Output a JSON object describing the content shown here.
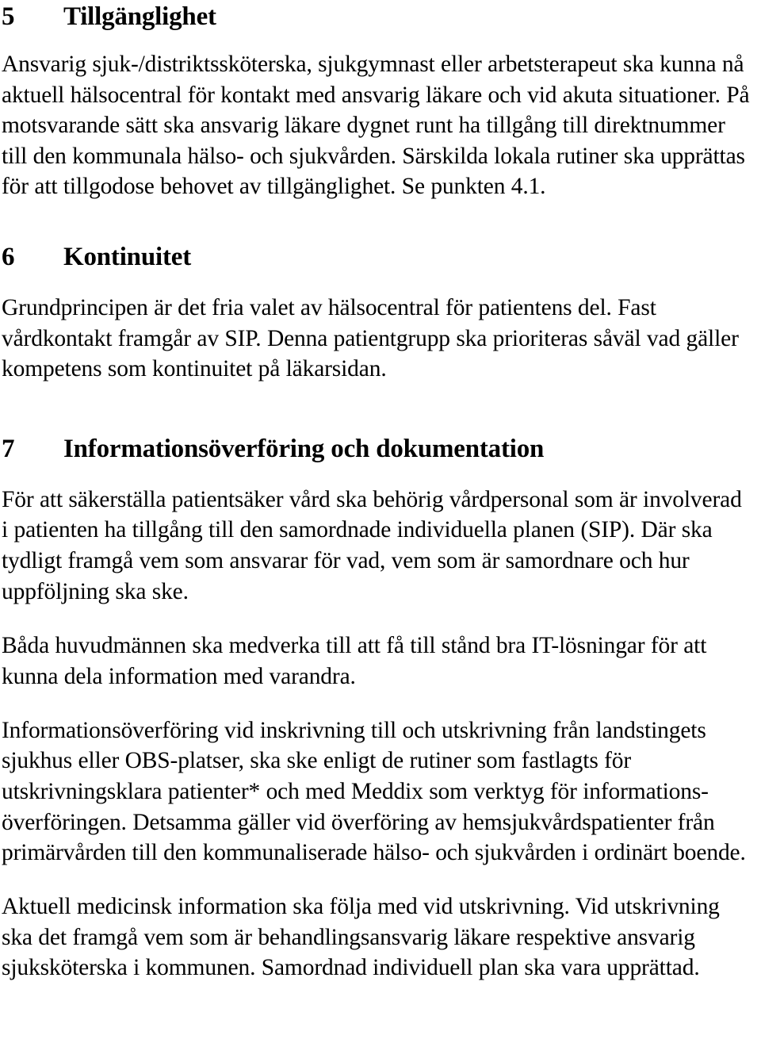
{
  "document": {
    "type": "scanned-text-page",
    "language": "sv",
    "background_color": "#ffffff",
    "text_color": "#000000"
  },
  "sections": [
    {
      "number": "5",
      "title": "Tillgänglighet",
      "paragraphs": [
        "Ansvarig sjuk-/distriktssköterska, sjukgymnast eller arbetsterapeut ska kunna nå\naktuell hälsocentral för kontakt med ansvarig läkare och vid akuta situationer. På\nmotsvarande sätt ska ansvarig läkare dygnet runt ha tillgång till direktnummer\ntill den kommunala hälso- och sjukvården. Särskilda lokala rutiner ska upprättas\nför att tillgodose behovet av tillgänglighet. Se punkten 4.1."
      ]
    },
    {
      "number": "6",
      "title": "Kontinuitet",
      "paragraphs": [
        "Grundprincipen är det fria valet av hälsocentral för patientens del. Fast\nvårdkontakt framgår av SIP. Denna patientgrupp ska prioriteras såväl vad gäller\nkompetens som kontinuitet på läkarsidan."
      ]
    },
    {
      "number": "7",
      "title": "Informationsöverföring och dokumentation",
      "paragraphs": [
        "För att säkerställa patientsäker vård ska behörig vårdpersonal som är involverad\ni patienten ha tillgång till den samordnade individuella planen (SIP). Där ska\ntydligt framgå vem som ansvarar för vad, vem som är samordnare och hur\nuppföljning ska ske.",
        "Båda huvudmännen ska medverka till att få till stånd bra IT-lösningar för att\nkunna dela information med varandra.",
        "Informationsöverföring vid inskrivning till och utskrivning från landstingets\nsjukhus eller OBS-platser, ska ske enligt de rutiner som fastlagts för\nutskrivningsklara patienter* och med Meddix som verktyg för informations-\növerföringen. Detsamma gäller vid överföring av hemsjukvårdspatienter från\nprimärvården till den kommunaliserade hälso- och sjukvården i ordinärt boende.",
        "Aktuell medicinsk information ska följa med vid utskrivning. Vid utskrivning\nska det framgå vem som är behandlingsansvarig läkare respektive ansvarig\nsjuksköterska i kommunen. Samordnad individuell plan ska vara upprättad."
      ]
    }
  ]
}
